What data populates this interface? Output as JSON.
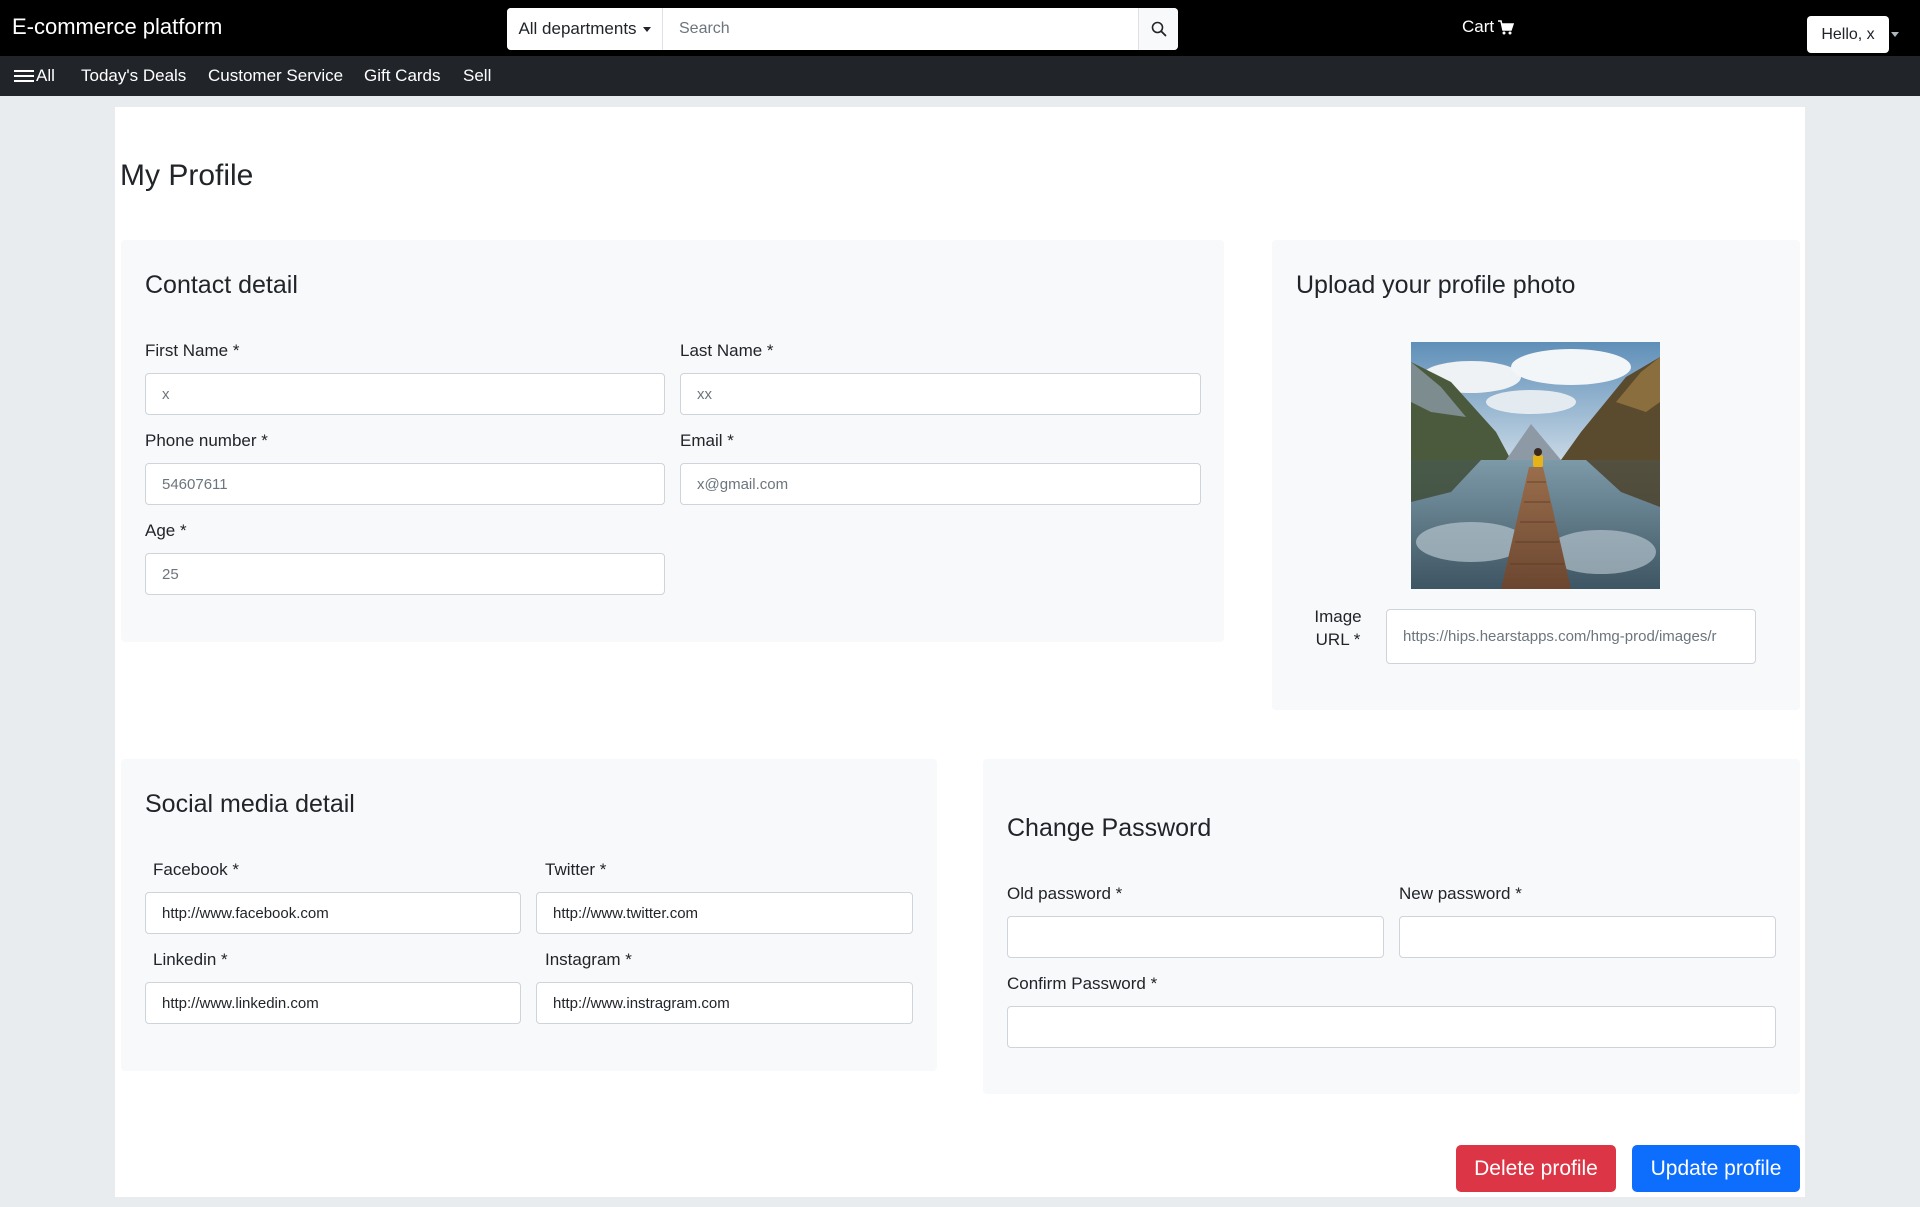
{
  "navbar": {
    "brand": "E-commerce platform",
    "department_label": "All departments",
    "search_placeholder": "Search",
    "cart_label": "Cart",
    "hello_label": "Hello, x"
  },
  "subnav": {
    "all_label": "All",
    "items": [
      "Today's Deals",
      "Customer Service",
      "Gift Cards",
      "Sell"
    ]
  },
  "page": {
    "title": "My Profile"
  },
  "contact": {
    "title": "Contact detail",
    "first_name_label": "First Name *",
    "first_name_value": "x",
    "last_name_label": "Last Name *",
    "last_name_value": "xx",
    "phone_label": "Phone number *",
    "phone_value": "54607611",
    "email_label": "Email *",
    "email_value": "x@gmail.com",
    "age_label": "Age *",
    "age_value": "25"
  },
  "photo": {
    "title": "Upload your profile photo",
    "image_url_label_line1": "Image",
    "image_url_label_line2": "URL *",
    "image_url_value": "https://hips.hearstapps.com/hmg-prod/images/r"
  },
  "social": {
    "title": "Social media detail",
    "facebook_label": "Facebook *",
    "facebook_value": "http://www.facebook.com",
    "twitter_label": "Twitter *",
    "twitter_value": "http://www.twitter.com",
    "linkedin_label": "Linkedin *",
    "linkedin_value": "http://www.linkedin.com",
    "instagram_label": "Instagram *",
    "instagram_value": "http://www.instragram.com"
  },
  "password": {
    "title": "Change Password",
    "old_label": "Old password *",
    "old_value": "",
    "new_label": "New password *",
    "new_value": "",
    "confirm_label": "Confirm Password *",
    "confirm_value": ""
  },
  "actions": {
    "delete_label": "Delete profile",
    "update_label": "Update profile"
  },
  "colors": {
    "topbar": "#000000",
    "subnav": "#212529",
    "card_bg": "#f8f9fa",
    "danger": "#dc3545",
    "primary": "#0d6efd"
  }
}
